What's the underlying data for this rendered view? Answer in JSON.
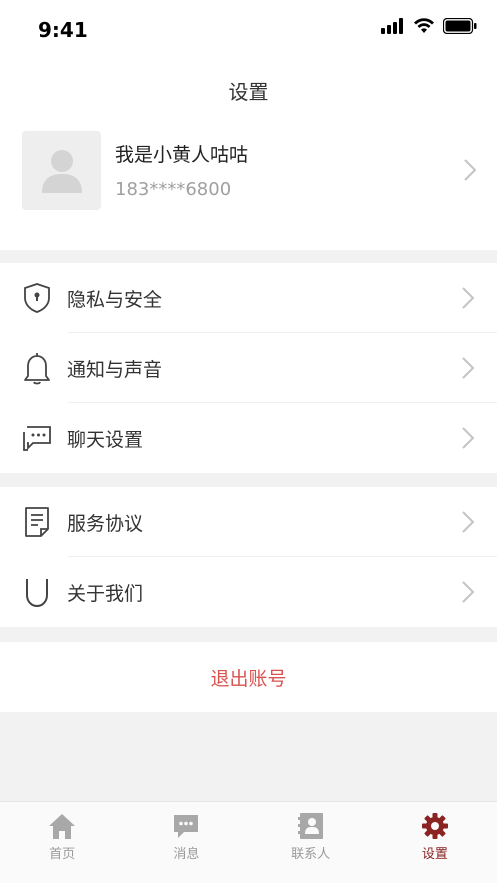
{
  "status_bar": {
    "time": "9:41"
  },
  "nav": {
    "title": "设置"
  },
  "profile": {
    "name": "我是小黄人咕咕",
    "phone": "183****6800"
  },
  "menu_group_1": [
    {
      "label": "隐私与安全",
      "icon": "shield-lock-icon"
    },
    {
      "label": "通知与声音",
      "icon": "bell-icon"
    },
    {
      "label": "聊天设置",
      "icon": "chat-bubble-icon"
    }
  ],
  "menu_group_2": [
    {
      "label": "服务协议",
      "icon": "document-icon"
    },
    {
      "label": "关于我们",
      "icon": "u-logo-icon"
    }
  ],
  "logout": {
    "label": "退出账号",
    "color": "#d9534f"
  },
  "tabbar": {
    "tabs": [
      {
        "label": "首页",
        "icon": "home-icon",
        "active": false
      },
      {
        "label": "消息",
        "icon": "message-icon",
        "active": false
      },
      {
        "label": "联系人",
        "icon": "contacts-icon",
        "active": false
      },
      {
        "label": "设置",
        "icon": "gear-icon",
        "active": true
      }
    ],
    "active_color": "#8b2323",
    "inactive_color": "#9a9a9a"
  }
}
